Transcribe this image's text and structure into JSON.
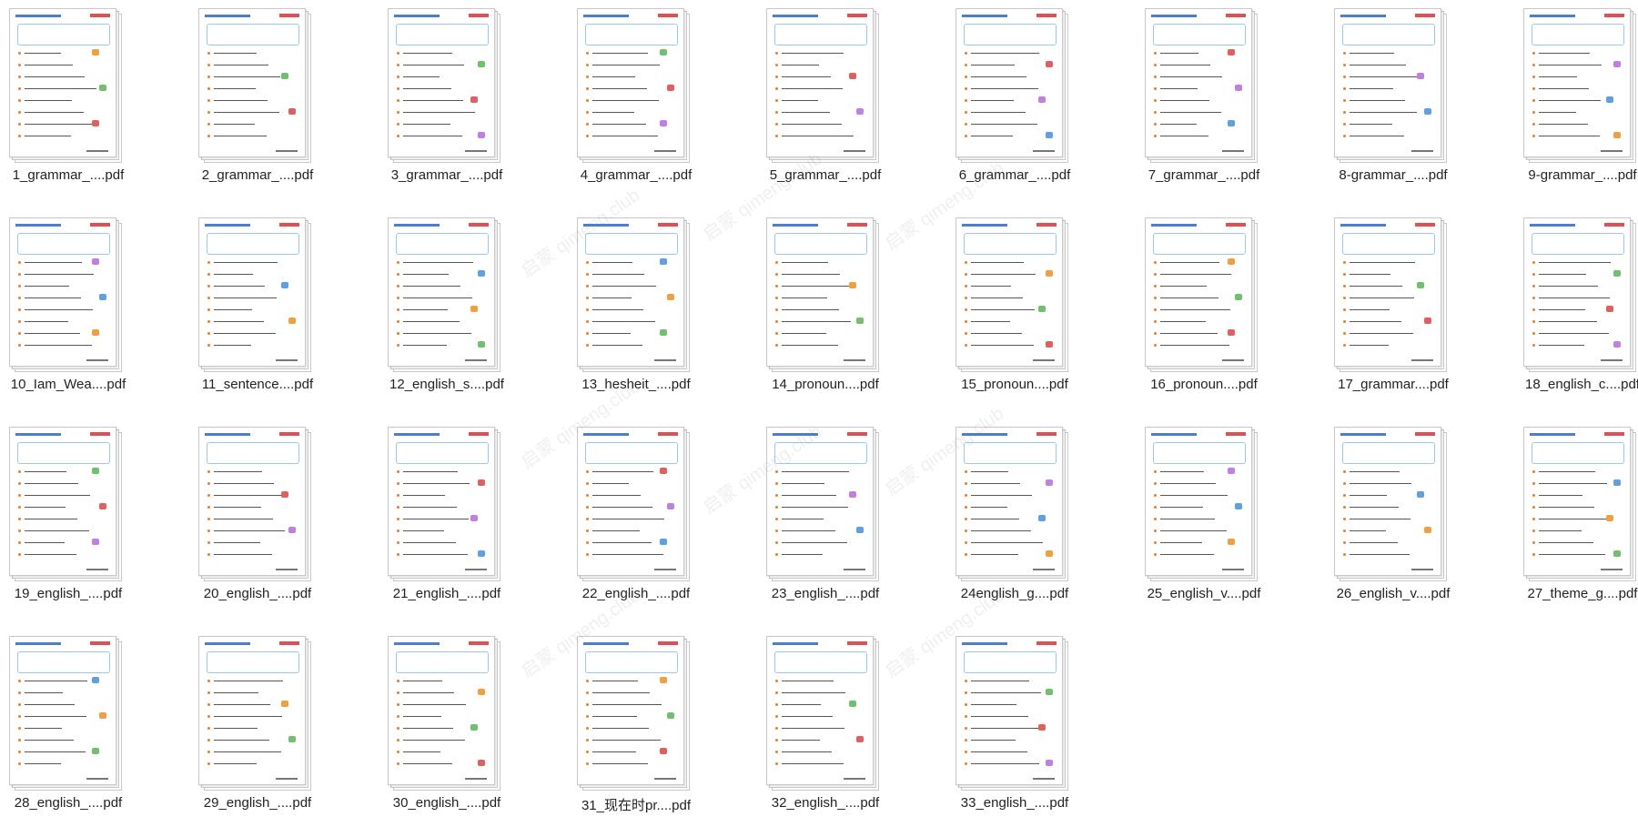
{
  "files": [
    "1_grammar_....pdf",
    "2_grammar_....pdf",
    "3_grammar_....pdf",
    "4_grammar_....pdf",
    "5_grammar_....pdf",
    "6_grammar_....pdf",
    "7_grammar_....pdf",
    "8-grammar_....pdf",
    "9-grammar_....pdf",
    "10_Iam_Wea....pdf",
    "11_sentence....pdf",
    "12_english_s....pdf",
    "13_hesheit_....pdf",
    "14_pronoun....pdf",
    "15_pronoun....pdf",
    "16_pronoun....pdf",
    "17_grammar....pdf",
    "18_english_c....pdf",
    "19_english_....pdf",
    "20_english_....pdf",
    "21_english_....pdf",
    "22_english_....pdf",
    "23_english_....pdf",
    "24english_g....pdf",
    "25_english_v....pdf",
    "26_english_v....pdf",
    "27_theme_g....pdf",
    "28_english_....pdf",
    "29_english_....pdf",
    "30_english_....pdf",
    "31_现在时pr....pdf",
    "32_english_....pdf",
    "33_english_....pdf"
  ],
  "file_icon": "pdf-thumbnail-icon",
  "watermark": "启蒙 qimeng.club",
  "colors": {
    "accent": "#4a7fd0",
    "logo": "#e05050",
    "label": "#222222"
  }
}
